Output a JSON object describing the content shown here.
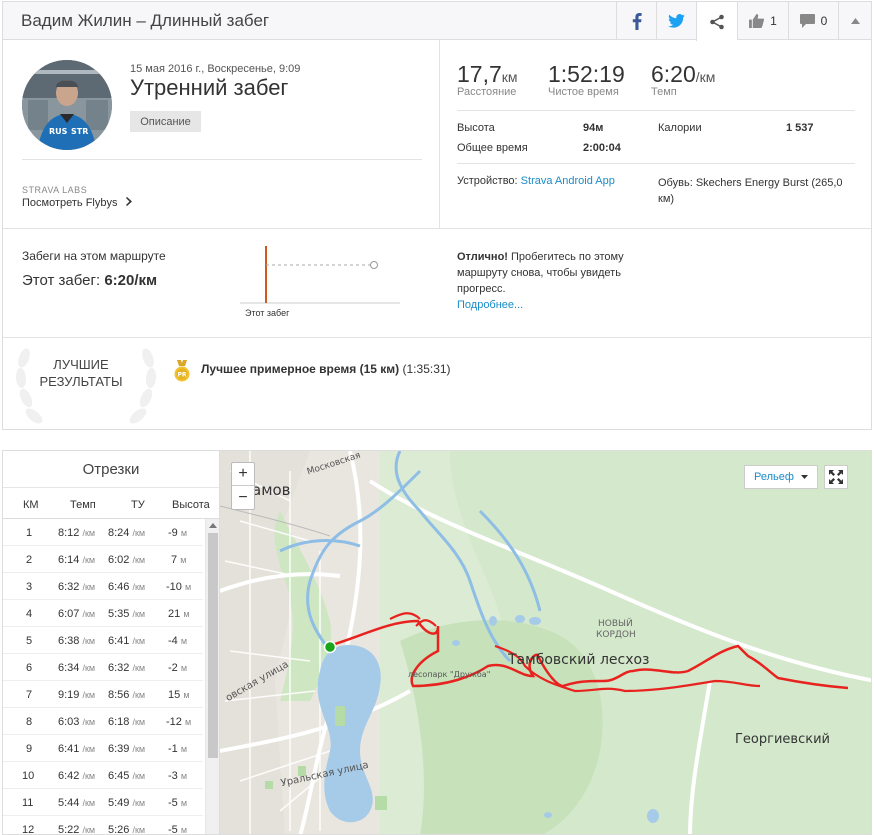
{
  "header": {
    "title": "Вадим Жилин – Длинный забег",
    "kudos_count": "1",
    "comments_count": "0"
  },
  "activity": {
    "date": "15 мая 2016 г., Воскресенье, 9:09",
    "name": "Утренний забег",
    "description_button": "Описание",
    "labs_label": "STRAVA LABS",
    "flyby_link": "Посмотреть Flybys"
  },
  "stats": {
    "distance": {
      "value": "17,7",
      "unit": "км",
      "label": "Расстояние"
    },
    "moving_time": {
      "value": "1:52:19",
      "label": "Чистое время"
    },
    "pace": {
      "value": "6:20",
      "unit": "/км",
      "label": "Темп"
    },
    "elevation_label": "Высота",
    "elevation_value": "94м",
    "elapsed_label": "Общее время",
    "elapsed_value": "2:00:04",
    "calories_label": "Калории",
    "calories_value": "1 537",
    "device_label": "Устройство:",
    "device_value": "Strava Android App",
    "shoes_label": "Обувь:",
    "shoes_value": "Skechers Energy Burst (265,0",
    "shoes_value2": "км)"
  },
  "route": {
    "title": "Забеги на этом маршруте",
    "this_run_label": "Этот забег:",
    "this_run_value": "6:20/км",
    "chart_caption": "Этот забег",
    "message_bold": "Отлично!",
    "message_line1": " Пробегитесь по этому",
    "message_line2": "маршруту снова, чтобы увидеть",
    "message_line3": "прогресс.",
    "more_link": "Подробнее..."
  },
  "best": {
    "title_line1": "ЛУЧШИЕ",
    "title_line2": "РЕЗУЛЬТАТЫ",
    "medal_text": "PR",
    "effort_bold": "Лучшее примерное время (15 км)",
    "effort_time": "(1:35:31)"
  },
  "splits": {
    "title": "Отрезки",
    "headers": [
      "КМ",
      "Темп",
      "ТУ",
      "Высота"
    ],
    "pace_unit": "/км",
    "elev_unit": "м",
    "rows": [
      {
        "km": "1",
        "pace": "8:12",
        "gap": "8:24",
        "elev": "-9"
      },
      {
        "km": "2",
        "pace": "6:14",
        "gap": "6:02",
        "elev": "7"
      },
      {
        "km": "3",
        "pace": "6:32",
        "gap": "6:46",
        "elev": "-10"
      },
      {
        "km": "4",
        "pace": "6:07",
        "gap": "5:35",
        "elev": "21"
      },
      {
        "km": "5",
        "pace": "6:38",
        "gap": "6:41",
        "elev": "-4"
      },
      {
        "km": "6",
        "pace": "6:34",
        "gap": "6:32",
        "elev": "-2"
      },
      {
        "km": "7",
        "pace": "9:19",
        "gap": "8:56",
        "elev": "15"
      },
      {
        "km": "8",
        "pace": "6:03",
        "gap": "6:18",
        "elev": "-12"
      },
      {
        "km": "9",
        "pace": "6:41",
        "gap": "6:39",
        "elev": "-1"
      },
      {
        "km": "10",
        "pace": "6:42",
        "gap": "6:45",
        "elev": "-3"
      },
      {
        "km": "11",
        "pace": "5:44",
        "gap": "5:49",
        "elev": "-5"
      },
      {
        "km": "12",
        "pace": "5:22",
        "gap": "5:26",
        "elev": "-5"
      }
    ]
  },
  "map": {
    "zoom_in": "+",
    "zoom_out": "−",
    "layer_button": "Рельеф",
    "labels": {
      "city_partial": "амов",
      "moskovskaya": "Московская",
      "ural_street": "Уральская улица",
      "street_left": "овская улица",
      "novy_kordon_1": "НОВЫЙ",
      "novy_kordon_2": "КОРДОН",
      "tambov_forest": "Тамбовский лесхоз",
      "park_druzhba": "лесопарк \"Дружба\"",
      "georgievsky": "Георгиевский"
    },
    "colors": {
      "route": "#e8231f",
      "water": "#a8cdea",
      "forest": "#c9e3bf",
      "start": "#1aa51a"
    }
  }
}
